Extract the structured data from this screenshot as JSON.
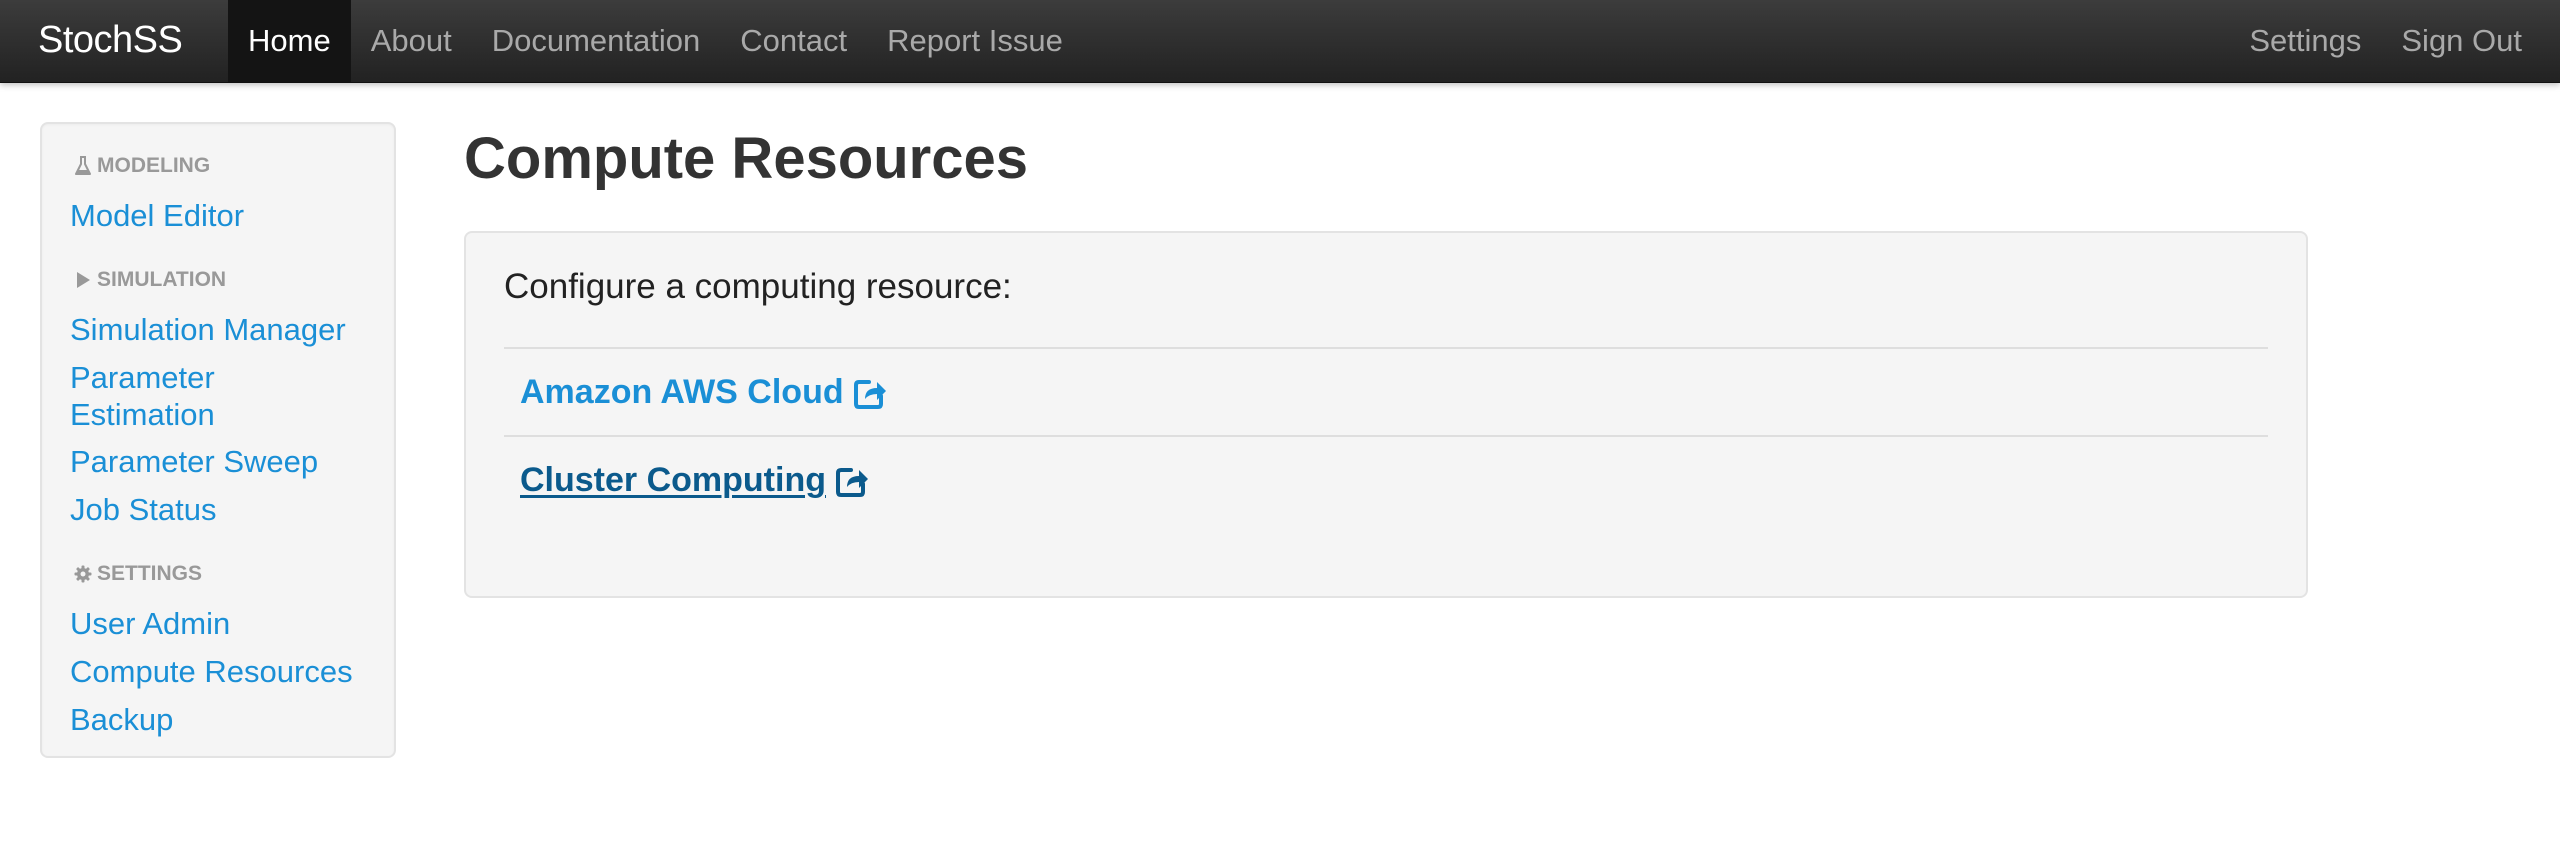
{
  "navbar": {
    "brand": "StochSS",
    "left_items": [
      {
        "label": "Home",
        "active": true
      },
      {
        "label": "About"
      },
      {
        "label": "Documentation"
      },
      {
        "label": "Contact"
      },
      {
        "label": "Report Issue"
      }
    ],
    "right_items": [
      {
        "label": "Settings"
      },
      {
        "label": "Sign Out"
      }
    ]
  },
  "sidebar": {
    "sections": [
      {
        "header": "MODELING",
        "icon": "flask-icon",
        "items": [
          "Model Editor"
        ]
      },
      {
        "header": "SIMULATION",
        "icon": "play-icon",
        "items": [
          "Simulation Manager",
          "Parameter Estimation",
          "Parameter Sweep",
          "Job Status"
        ]
      },
      {
        "header": "SETTINGS",
        "icon": "gear-icon",
        "items": [
          "User Admin",
          "Compute Resources",
          "Backup"
        ]
      }
    ]
  },
  "main": {
    "title": "Compute Resources",
    "intro": "Configure a computing resource:",
    "resources": [
      {
        "label": "Amazon AWS Cloud",
        "icon": "external-link-icon"
      },
      {
        "label": "Cluster Computing",
        "icon": "external-link-icon",
        "visited": true
      }
    ]
  },
  "colors": {
    "navbar_bg": "#222222",
    "link": "#1a8fd6",
    "link_visited": "#0b5a8c",
    "panel_bg": "#f5f5f5"
  }
}
